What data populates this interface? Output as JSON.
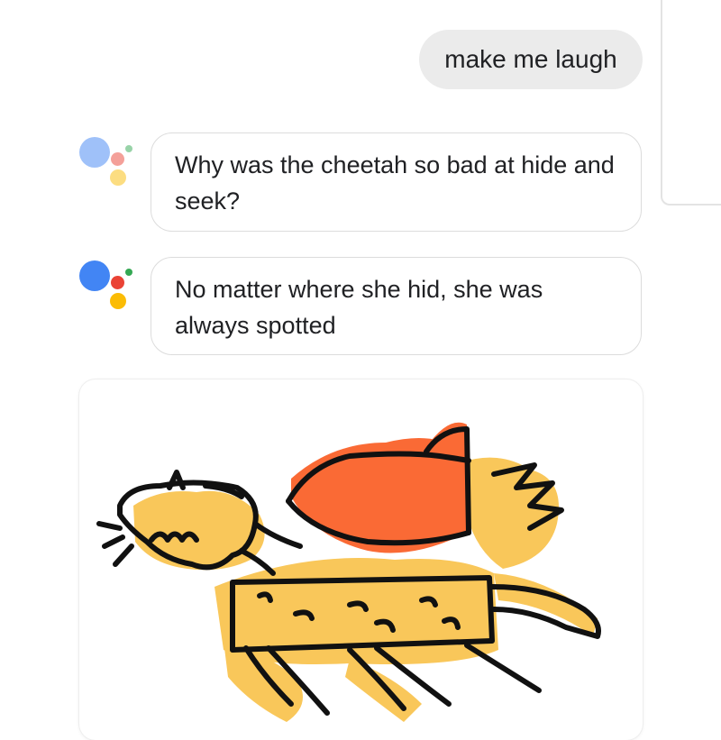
{
  "conversation": {
    "user_message": "make me laugh",
    "assistant_messages": [
      "Why was the cheetah so bad at hide and seek?",
      "No matter where she hid, she was always spotted"
    ]
  },
  "assistant_logo_colors": {
    "blue": "#4285F4",
    "red": "#EA4335",
    "yellow": "#FBBC05",
    "green": "#34A853"
  },
  "drawing": {
    "icon": "cheetah-drawing",
    "colors": {
      "body": "#f9c75a",
      "cape": "#fa6a35",
      "outline": "#111111"
    }
  }
}
